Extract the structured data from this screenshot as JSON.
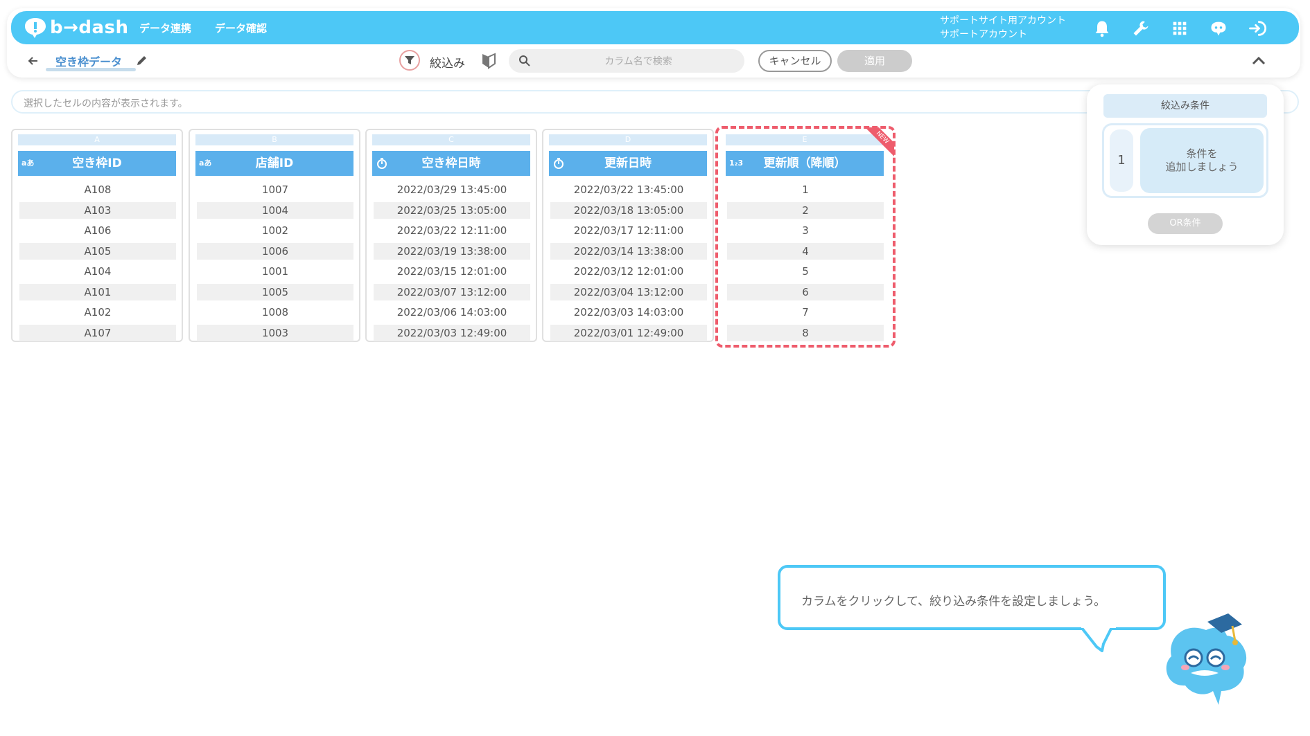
{
  "header": {
    "logo_text": "b→dash",
    "nav": [
      "データ連携",
      "データ確認"
    ],
    "account_line1": "サポートサイト用アカウント",
    "account_line2": "サポートアカウント"
  },
  "toolbar": {
    "title": "空き枠データ",
    "filter_label": "絞込み",
    "search_placeholder": "カラム名で検索",
    "cancel_label": "キャンセル",
    "apply_label": "適用"
  },
  "cellbar": {
    "text": "選択したセルの内容が表示されます。"
  },
  "columns": [
    {
      "letter": "A",
      "type": "aあ",
      "name": "空き枠ID",
      "values": [
        "A108",
        "A103",
        "A106",
        "A105",
        "A104",
        "A101",
        "A102",
        "A107"
      ]
    },
    {
      "letter": "B",
      "type": "aあ",
      "name": "店舗ID",
      "values": [
        "1007",
        "1004",
        "1002",
        "1006",
        "1001",
        "1005",
        "1008",
        "1003"
      ]
    },
    {
      "letter": "C",
      "type": "datetime",
      "name": "空き枠日時",
      "values": [
        "2022/03/29 13:45:00",
        "2022/03/25 13:05:00",
        "2022/03/22 12:11:00",
        "2022/03/19 13:38:00",
        "2022/03/15 12:01:00",
        "2022/03/07 13:12:00",
        "2022/03/06 14:03:00",
        "2022/03/03 12:49:00"
      ]
    },
    {
      "letter": "D",
      "type": "datetime",
      "name": "更新日時",
      "values": [
        "2022/03/22 13:45:00",
        "2022/03/18 13:05:00",
        "2022/03/17 12:11:00",
        "2022/03/14 13:38:00",
        "2022/03/12 12:01:00",
        "2022/03/04 13:12:00",
        "2022/03/03 14:03:00",
        "2022/03/01 12:49:00"
      ]
    },
    {
      "letter": "E",
      "type": "1₂3",
      "name": "更新順（降順）",
      "values": [
        "1",
        "2",
        "3",
        "4",
        "5",
        "6",
        "7",
        "8"
      ]
    }
  ],
  "new_badge": "NEW",
  "conditions_panel": {
    "title": "絞込み条件",
    "number": "1",
    "add_line1": "条件を",
    "add_line2": "追加しましょう",
    "or_button": "OR条件"
  },
  "hint": {
    "text": "カラムをクリックして、絞り込み条件を設定しましょう。"
  },
  "colors": {
    "header": "#4dc8f6",
    "column_head": "#5bb0eb",
    "highlight": "#ee5c6c"
  }
}
